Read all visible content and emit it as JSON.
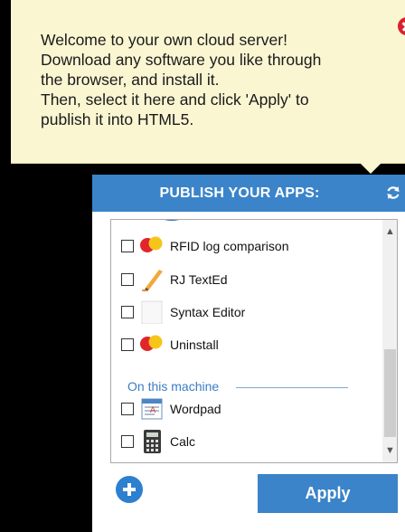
{
  "tooltip": {
    "message": "Welcome to your own cloud server!\nDownload any software you like through\nthe browser, and install it.\nThen, select it here and click 'Apply' to\npublish it into HTML5."
  },
  "panel": {
    "title": "PUBLISH YOUR APPS:",
    "apps": [
      {
        "label": "RFID log comparison",
        "icon": "red-yellow-circles-icon",
        "checked": false
      },
      {
        "label": "RJ TextEd",
        "icon": "pencil-icon",
        "checked": false
      },
      {
        "label": "Syntax Editor",
        "icon": "blank-document-icon",
        "checked": false
      },
      {
        "label": "Uninstall",
        "icon": "red-yellow-circles-icon",
        "checked": false
      }
    ],
    "section_label": "On this machine",
    "machine_apps": [
      {
        "label": "Wordpad",
        "icon": "wordpad-icon",
        "checked": false
      },
      {
        "label": "Calc",
        "icon": "calculator-icon",
        "checked": false
      }
    ],
    "apply_label": "Apply"
  },
  "colors": {
    "accent": "#3b84c9",
    "tooltip_bg": "#fbf6d2",
    "close": "#d8212f"
  }
}
